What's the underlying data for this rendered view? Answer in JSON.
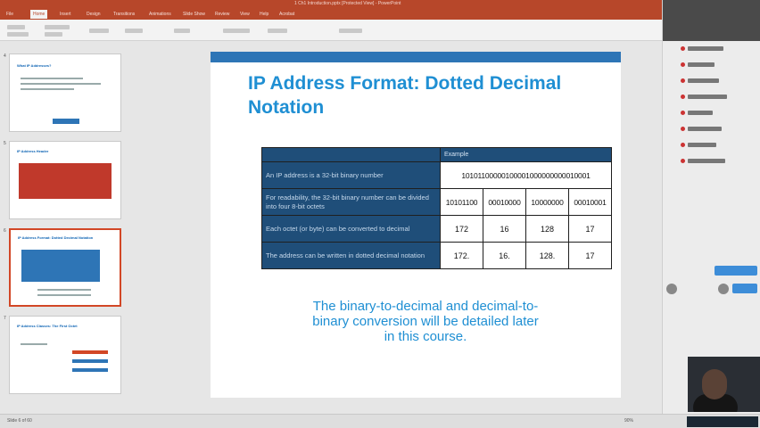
{
  "app": {
    "window_title": "1 Ch1 Introduction.pptx [Protected View] - PowerPoint",
    "tabs": [
      "File",
      "Home",
      "Insert",
      "Design",
      "Transitions",
      "Animations",
      "Slide Show",
      "Review",
      "View",
      "Help",
      "Acrobat"
    ],
    "active_tab": "Home"
  },
  "thumbnails": {
    "slides": [
      {
        "num": "4",
        "title": "What IP Addresses?"
      },
      {
        "num": "5",
        "title": "IP Address Header"
      },
      {
        "num": "6",
        "title": "IP Address Format: Dotted Decimal Notation"
      },
      {
        "num": "7",
        "title": "IP Address Classes: The First Octet"
      }
    ]
  },
  "slide": {
    "title_line1": "IP Address Format: Dotted Decimal",
    "title_line2": "Notation",
    "table": {
      "header_example": "Example",
      "rows": [
        {
          "desc": "An IP address is a 32-bit binary number",
          "values": [
            "10101100000100001000000000010001"
          ]
        },
        {
          "desc": "For readability, the 32-bit binary number can be divided into four 8-bit octets",
          "values": [
            "10101100",
            "00010000",
            "10000000",
            "00010001"
          ]
        },
        {
          "desc": "Each octet (or byte) can be converted to decimal",
          "values": [
            "172",
            "16",
            "128",
            "17"
          ]
        },
        {
          "desc": "The address can be written in dotted decimal notation",
          "values": [
            "172.",
            "16.",
            "128.",
            "17"
          ]
        }
      ]
    },
    "note_line1": "The binary-to-decimal and decimal-to-",
    "note_line2": "binary conversion will be detailed later",
    "note_line3": "in this course."
  },
  "status": {
    "left": "Slide 6 of 60",
    "zoom": "90%"
  },
  "colors": {
    "accent": "#b7472a",
    "title_blue": "#1f8fd3",
    "table_dark": "#1f4e79"
  }
}
